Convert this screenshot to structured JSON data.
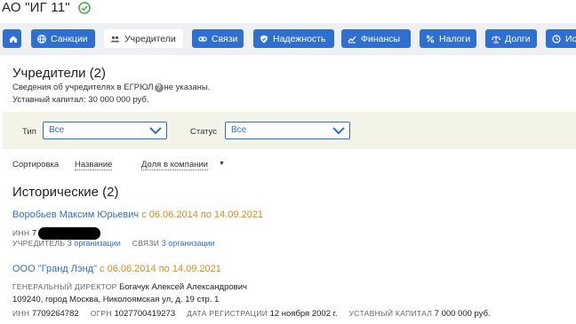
{
  "header": {
    "company_title": "АО \"ИГ 11\""
  },
  "tabs": [
    {
      "label": "",
      "icon": "home-icon"
    },
    {
      "label": "Санкции",
      "icon": "globe-icon"
    },
    {
      "label": "Учредители",
      "icon": "people-icon"
    },
    {
      "label": "Связи",
      "icon": "link-icon"
    },
    {
      "label": "Надежность",
      "icon": "shield-icon"
    },
    {
      "label": "Финансы",
      "icon": "chart-icon"
    },
    {
      "label": "Налоги",
      "icon": "percent-icon"
    },
    {
      "label": "Долги",
      "icon": "scales-icon"
    },
    {
      "label": "Ис",
      "icon": "history-icon"
    }
  ],
  "founders": {
    "title": "Учредители (2)",
    "egrul_note_before": "Сведения об учредителях в ЕГРЮЛ",
    "egrul_note_after": "не указаны.",
    "capital": "Уставный капитал: 30 000 000 руб."
  },
  "filters": {
    "type_label": "Тип",
    "type_value": "Все",
    "status_label": "Статус",
    "status_value": "Все"
  },
  "sort": {
    "label": "Сортировка",
    "by_name": "Название",
    "by_share": "Доля в компании"
  },
  "historical": {
    "title": "Исторические (2)",
    "items": [
      {
        "name": "Воробьев Максим Юрьевич",
        "dates": "с 06.06.2014 по 14.09.2021",
        "inn_label": "ИНН",
        "inn_value": "7",
        "founder_label": "УЧРЕДИТЕЛЬ",
        "founder_link": "3 организации",
        "links_label": "СВЯЗИ",
        "links_link": "3 организации"
      },
      {
        "name": "ООО \"Гранд Лэнд\"",
        "dates": "с 06.06.2014 по 14.09.2021",
        "director_label": "ГЕНЕРАЛЬНЫЙ ДИРЕКТОР",
        "director_name": "Богачук Алексей Александрович",
        "address": "109240, город Москва, Николоямская ул, д. 19 стр. 1",
        "inn_label": "ИНН",
        "inn_value": "7709264782",
        "ogrn_label": "ОГРН",
        "ogrn_value": "1027700419273",
        "reg_label": "ДАТА РЕГИСТРАЦИИ",
        "reg_value": "12 ноября 2002 г.",
        "capital_label": "УСТАВНЫЙ КАПИТАЛ",
        "capital_value": "7 000 000 руб."
      }
    ]
  },
  "colors": {
    "accent": "#2f6fcf",
    "dates": "#d98a1c",
    "filter_bg": "#f4f3e8",
    "ok_green": "#3cb043"
  }
}
